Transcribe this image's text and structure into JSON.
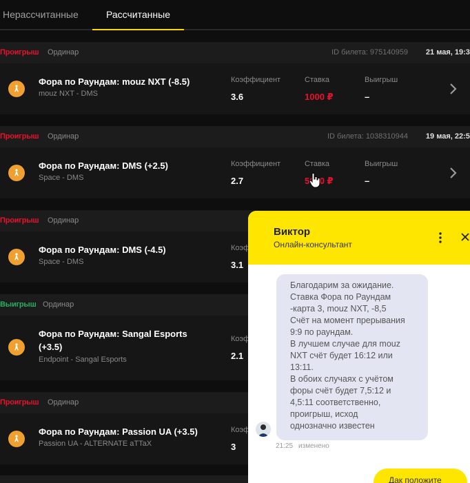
{
  "tabs": {
    "unsettled": "Нерассчитанные",
    "settled": "Рассчитанные"
  },
  "labels": {
    "coefficient": "Коэффициент",
    "stake": "Ставка",
    "winnings": "Выигрыш"
  },
  "bets": [
    {
      "status": "Проигрыш",
      "status_type": "lose",
      "type": "Ординар",
      "ticket": "ID билета: 975140959",
      "date": "21 мая, 19:37",
      "title": "Фора по Раундам: mouz NXT (-8.5)",
      "match": "mouz NXT - DMS",
      "coef": "3.6",
      "stake": "1000 ₽",
      "win": "–"
    },
    {
      "status": "Проигрыш",
      "status_type": "lose",
      "type": "Ординар",
      "ticket": "ID билета: 1038310944",
      "date": "19 мая, 22:59",
      "title": "Фора по Раундам: DMS (+2.5)",
      "match": "Space - DMS",
      "coef": "2.7",
      "stake": "5000 ₽",
      "win": "–"
    },
    {
      "status": "Проигрыш",
      "status_type": "lose",
      "type": "Ординар",
      "title": "Фора по Раундам: DMS (-4.5)",
      "match": "Space - DMS",
      "coef": "3.1",
      "label_partial": "Коэф"
    },
    {
      "status": "Выигрыш",
      "status_type": "win",
      "type": "Ординар",
      "title": "Фора по Раундам: Sangal Esports (+3.5)",
      "match": "Endpoint - Sangal Esports",
      "coef": "2.1",
      "label_partial": "Коэф"
    },
    {
      "status": "Проигрыш",
      "status_type": "lose",
      "type": "Ординар",
      "title": "Фора по Раундам: Passion UA (+3.5)",
      "match": "Passion UA - ALTERNATE aTTaX",
      "coef": "3",
      "label_partial": "Коэф"
    }
  ],
  "chat": {
    "agent_name": "Виктор",
    "agent_role": "Онлайн-консультант",
    "message_lines": [
      "Благодарим за ожидание.",
      "Ставка Фора по Раундам",
      "-карта 3, mouz NXT, -8,5",
      "Счёт на момент прерывания",
      "9:9 по раундам.",
      "В лучшем случае для mouz",
      "NXT счёт будет 16:12 или",
      "13:11.",
      "В обоих случаях с учётом",
      "форы счёт будет 7,5:12 и",
      "4,5:11 соответственно,",
      "проигрыш, исход",
      "однозначно известен"
    ],
    "time": "21:25",
    "edited": "изменено",
    "reply": "Дак положите"
  },
  "colors": {
    "accent": "#ffe600",
    "lose": "#e8112d",
    "win": "#27ae60",
    "icon": "#f0a030"
  }
}
